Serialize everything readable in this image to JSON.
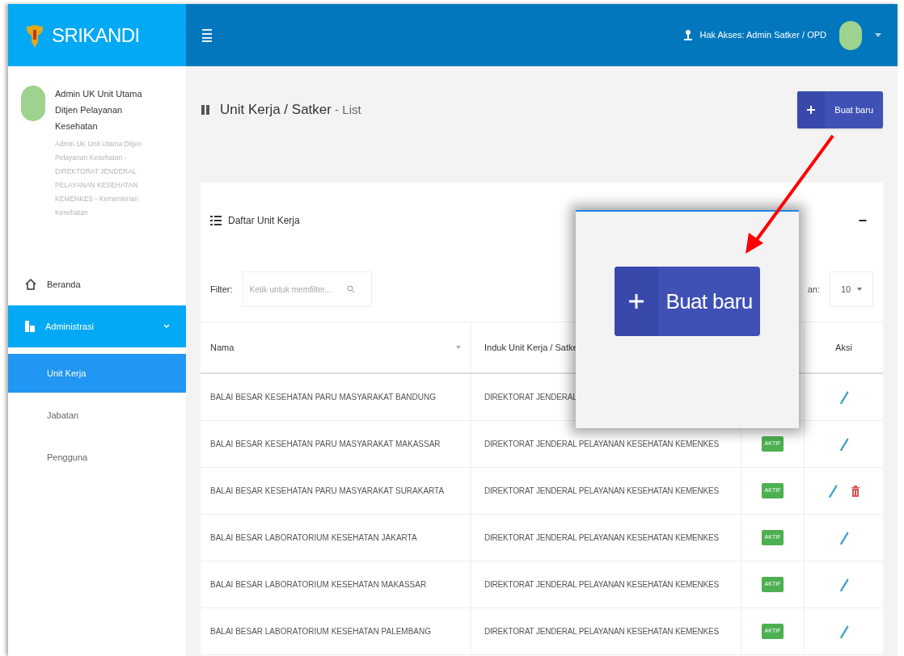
{
  "brand": "SRIKANDI",
  "header": {
    "access": "Hak Akses: Admin Satker / OPD"
  },
  "user": {
    "name": "Admin UK Unit Utama Ditjen Pelayanan Kesehatan",
    "detail": "Admin UK Unit Utama Ditjen Pelayanan Kesehatan - DIREKTORAT JENDERAL PELAYANAN KESEHATAN KEMENKES - Kementerian Kesehatan"
  },
  "sidebar": {
    "items": [
      {
        "label": "Beranda",
        "kind": "home",
        "selected": false
      },
      {
        "label": "Administrasi",
        "kind": "admin",
        "selected": true,
        "expanded": true,
        "children": [
          {
            "label": "Unit Kerja",
            "selected": true
          },
          {
            "label": "Jabatan",
            "selected": false
          },
          {
            "label": "Pengguna",
            "selected": false
          }
        ]
      }
    ]
  },
  "page_title": {
    "main": "Unit Kerja / Satker",
    "suffix": " - List"
  },
  "new_button": "Buat baru",
  "card": {
    "title": "Daftar Unit Kerja",
    "collapse": "−",
    "filter_label": "Filter:",
    "filter_placeholder": "Ketik untuk memfilter...",
    "show_label": "an:",
    "page_size": "10"
  },
  "table": {
    "columns": [
      "Nama",
      "Induk Unit Kerja / Satke",
      "Aksi"
    ],
    "rows": [
      {
        "nama": "BALAI BESAR KESEHATAN PARU MASYARAKAT BANDUNG",
        "induk": "DIREKTORAT JENDERAL",
        "can_delete": false
      },
      {
        "nama": "BALAI BESAR KESEHATAN PARU MASYARAKAT MAKASSAR",
        "induk": "DIREKTORAT JENDERAL PELAYANAN KESEHATAN KEMENKES",
        "status": "AKTIF",
        "can_delete": false
      },
      {
        "nama": "BALAI BESAR KESEHATAN PARU MASYARAKAT SURAKARTA",
        "induk": "DIREKTORAT JENDERAL PELAYANAN KESEHATAN KEMENKES",
        "status": "AKTIF",
        "can_delete": true
      },
      {
        "nama": "BALAI BESAR LABORATORIUM KESEHATAN JAKARTA",
        "induk": "DIREKTORAT JENDERAL PELAYANAN KESEHATAN KEMENKES",
        "status": "AKTIF",
        "can_delete": false
      },
      {
        "nama": "BALAI BESAR LABORATORIUM KESEHATAN MAKASSAR",
        "induk": "DIREKTORAT JENDERAL PELAYANAN KESEHATAN KEMENKES",
        "status": "AKTIF",
        "can_delete": false
      },
      {
        "nama": "BALAI BESAR LABORATORIUM KESEHATAN PALEMBANG",
        "induk": "DIREKTORAT JENDERAL PELAYANAN KESEHATAN KEMENKES",
        "status": "AKTIF",
        "can_delete": false
      }
    ]
  },
  "zoom_inset": {
    "button": "Buat baru"
  }
}
